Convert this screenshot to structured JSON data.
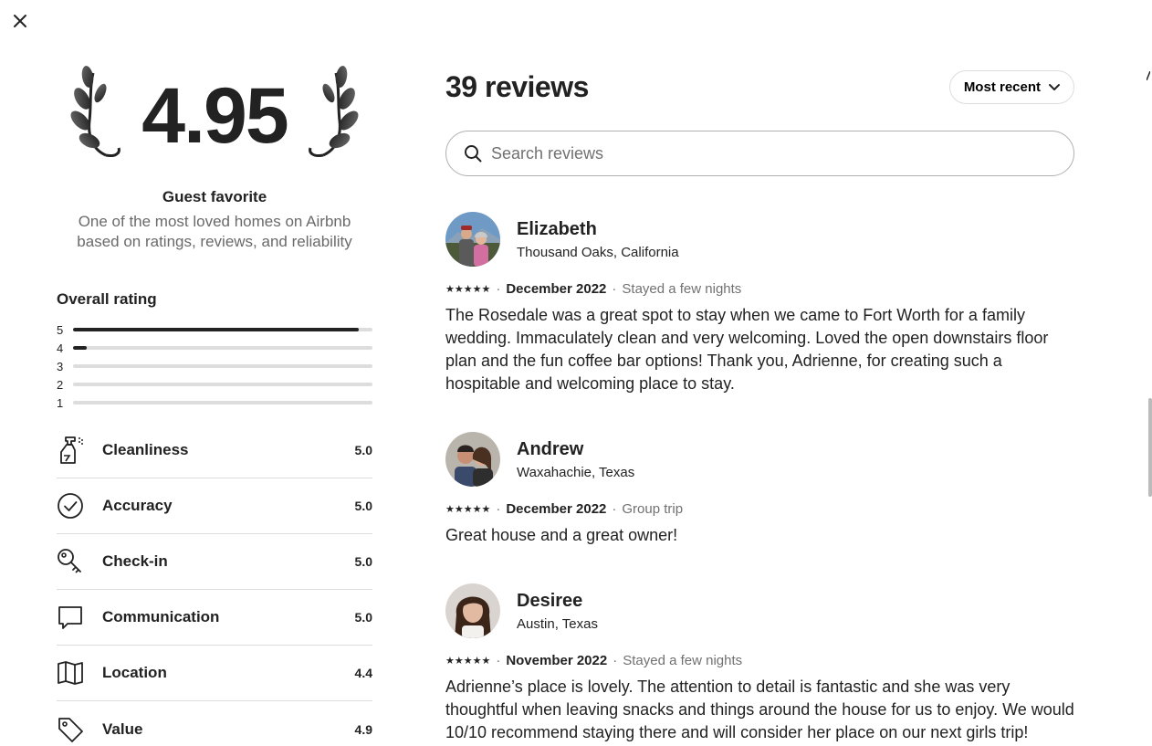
{
  "modal": {
    "close_label": "Close"
  },
  "summary": {
    "score": "4.95",
    "badge_title": "Guest favorite",
    "badge_desc": "One of the most loved homes on Airbnb based on ratings, reviews, and reliability",
    "overall_title": "Overall rating",
    "distribution": [
      {
        "stars": "5",
        "fraction": 0.955
      },
      {
        "stars": "4",
        "fraction": 0.045
      },
      {
        "stars": "3",
        "fraction": 0
      },
      {
        "stars": "2",
        "fraction": 0
      },
      {
        "stars": "1",
        "fraction": 0
      }
    ],
    "categories": [
      {
        "label": "Cleanliness",
        "score": "5.0",
        "icon": "spray-bottle-icon"
      },
      {
        "label": "Accuracy",
        "score": "5.0",
        "icon": "check-circle-icon"
      },
      {
        "label": "Check-in",
        "score": "5.0",
        "icon": "key-icon"
      },
      {
        "label": "Communication",
        "score": "5.0",
        "icon": "chat-bubble-icon"
      },
      {
        "label": "Location",
        "score": "4.4",
        "icon": "map-icon"
      },
      {
        "label": "Value",
        "score": "4.9",
        "icon": "price-tag-icon"
      }
    ]
  },
  "reviews_panel": {
    "count_label": "39 reviews",
    "sort_label": "Most recent",
    "search_placeholder": "Search reviews",
    "reviews": [
      {
        "name": "Elizabeth",
        "location": "Thousand Oaks, California",
        "stars": "★★★★★",
        "date": "December 2022",
        "trip": "Stayed a few nights",
        "text": "The Rosedale was a great spot to stay when we came to Fort Worth for a family wedding. Immaculately clean and very welcoming. Loved the open downstairs floor plan and the fun coffee bar options! Thank you, Adrienne, for creating such a hospitable and welcoming place to stay."
      },
      {
        "name": "Andrew",
        "location": "Waxahachie, Texas",
        "stars": "★★★★★",
        "date": "December 2022",
        "trip": "Group trip",
        "text": "Great house and a great owner!"
      },
      {
        "name": "Desiree",
        "location": "Austin, Texas",
        "stars": "★★★★★",
        "date": "November 2022",
        "trip": "Stayed a few nights",
        "text": "Adrienne’s place is lovely. The attention to detail is fantastic and she was very thoughtful when leaving snacks and things around the house for us to enjoy. We would 10/10 recommend staying there and will consider her place on our next girls trip!"
      }
    ]
  },
  "colors": {
    "text": "#222222",
    "muted": "#6a6a6a",
    "border": "#dddddd",
    "bar_fill": "#222222"
  }
}
